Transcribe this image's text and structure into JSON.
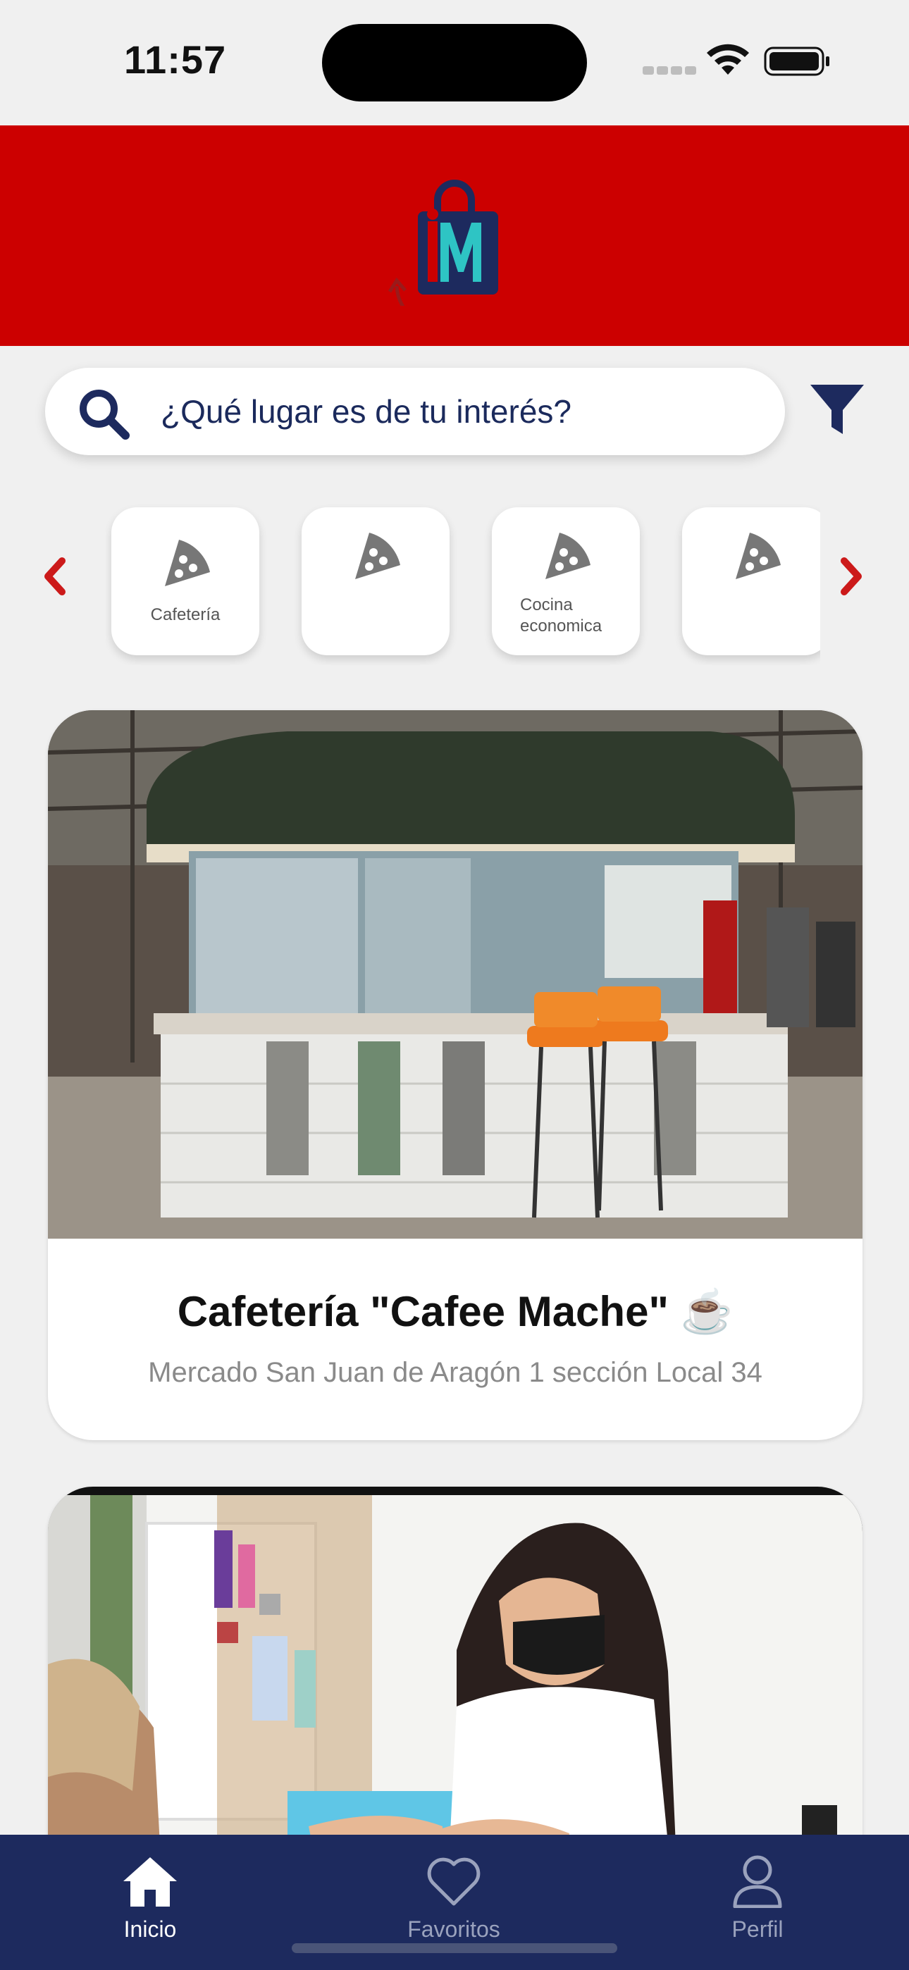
{
  "status_bar": {
    "time": "11:57"
  },
  "header": {
    "logo_icon": "shopping-bag-im-logo",
    "brand_color": "#cc0000",
    "accent_navy": "#1d2a5e"
  },
  "search": {
    "placeholder": "¿Qué lugar es de tu interés?",
    "icon": "search-icon",
    "filter_icon": "filter-icon"
  },
  "categories": {
    "items": [
      {
        "label": "Cafetería",
        "icon": "pizza-slice-icon"
      },
      {
        "label": "",
        "icon": "pizza-slice-icon"
      },
      {
        "label": "Cocina economica",
        "icon": "pizza-slice-icon"
      },
      {
        "label": "",
        "icon": "pizza-slice-icon"
      }
    ]
  },
  "places": [
    {
      "title": "Cafetería \"Cafee Mache\" ☕️",
      "address": "Mercado San Juan de Aragón 1 sección Local 34"
    },
    {
      "title": "",
      "address": ""
    }
  ],
  "tab_bar": {
    "tabs": [
      {
        "label": "Inicio",
        "icon": "home-icon",
        "active": true
      },
      {
        "label": "Favoritos",
        "icon": "heart-icon",
        "active": false
      },
      {
        "label": "Perfil",
        "icon": "user-icon",
        "active": false
      }
    ]
  }
}
